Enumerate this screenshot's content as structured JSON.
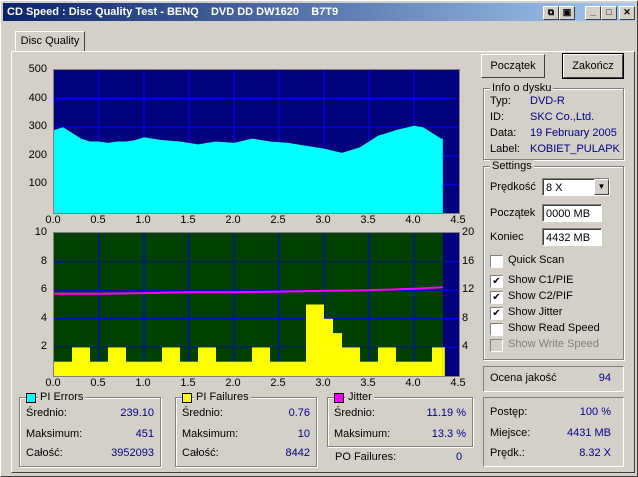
{
  "window": {
    "title": "CD Speed : Disc Quality Test - BENQ    DVD DD DW1620    B7T9",
    "tab": "Disc Quality"
  },
  "buttons": {
    "start": "Początek",
    "stop": "Zakończ"
  },
  "disc_info": {
    "title": "Info o dysku",
    "type_label": "Typ:",
    "type": "DVD-R",
    "id_label": "ID:",
    "id": "SKC Co.,Ltd.",
    "date_label": "Data:",
    "date": "19 February 2005",
    "label_label": "Label:",
    "label": "KOBIET_PULAPKA"
  },
  "settings": {
    "title": "Settings",
    "speed_label": "Prędkość",
    "speed": "8 X",
    "start_label": "Początek",
    "start": "0000 MB",
    "end_label": "Koniec",
    "end": "4432 MB",
    "quick_scan": "Quick Scan",
    "show_c1": "Show C1/PIE",
    "show_c2": "Show C2/PIF",
    "show_jitter": "Show Jitter",
    "show_read": "Show Read Speed",
    "show_write": "Show Write Speed"
  },
  "quality": {
    "label": "Ocena jakość",
    "value": "94"
  },
  "progress": {
    "progress_label": "Postęp:",
    "progress": "100 %",
    "position_label": "Miejsce:",
    "position": "4431 MB",
    "speed_label": "Prędk.:",
    "speed": "8.32 X"
  },
  "stats": {
    "pi_errors": {
      "title": "PI Errors",
      "avg_label": "Średnio:",
      "avg": "239.10",
      "max_label": "Maksimum:",
      "max": "451",
      "total_label": "Całość:",
      "total": "3952093"
    },
    "pi_failures": {
      "title": "PI Failures",
      "avg_label": "Średnio:",
      "avg": "0.76",
      "max_label": "Maksimum:",
      "max": "10",
      "total_label": "Całość:",
      "total": "8442"
    },
    "jitter": {
      "title": "Jitter",
      "avg_label": "Średnio:",
      "avg": "11.19 %",
      "max_label": "Maksimum:",
      "max": "13.3 %"
    },
    "po_failures": {
      "label": "PO Failures:",
      "value": "0"
    }
  },
  "colors": {
    "pie": "#00ffff",
    "pif": "#ffff00",
    "jitter": "#ff00ff",
    "chart_bg": "#00007d",
    "chart2_bg": "#004000",
    "grid": "#0000ff"
  },
  "chart_data": [
    {
      "type": "area",
      "series": [
        {
          "name": "PI Errors",
          "x": [
            0,
            0.1,
            0.2,
            0.3,
            0.4,
            0.5,
            0.6,
            0.7,
            0.8,
            0.9,
            1.0,
            1.2,
            1.4,
            1.6,
            1.8,
            2.0,
            2.2,
            2.4,
            2.6,
            2.8,
            3.0,
            3.2,
            3.4,
            3.6,
            3.8,
            4.0,
            4.1,
            4.2,
            4.3,
            4.32
          ],
          "values": [
            290,
            300,
            280,
            260,
            250,
            250,
            245,
            250,
            250,
            255,
            265,
            255,
            250,
            240,
            250,
            245,
            260,
            250,
            245,
            235,
            225,
            210,
            230,
            270,
            290,
            305,
            300,
            280,
            260,
            260
          ]
        }
      ],
      "xlim": [
        0,
        4.5
      ],
      "ylim": [
        0,
        500
      ],
      "x_ticks": [
        "0.0",
        "0.5",
        "1.0",
        "1.5",
        "2.0",
        "2.5",
        "3.0",
        "3.5",
        "4.0",
        "4.5"
      ],
      "y_ticks": [
        "500",
        "400",
        "300",
        "200",
        "100"
      ]
    },
    {
      "type": "bar",
      "series": [
        {
          "name": "PI Failures",
          "x": [
            0,
            0.2,
            0.4,
            0.6,
            0.8,
            1.0,
            1.2,
            1.4,
            1.6,
            1.8,
            2.0,
            2.2,
            2.4,
            2.6,
            2.8,
            2.9,
            3.0,
            3.1,
            3.2,
            3.4,
            3.6,
            3.8,
            4.0,
            4.2,
            4.32
          ],
          "values": [
            1,
            2,
            1,
            2,
            1,
            1,
            2,
            1,
            2,
            1,
            1,
            2,
            1,
            1,
            5,
            5,
            4,
            3,
            2,
            1,
            2,
            1,
            1,
            2,
            2
          ]
        },
        {
          "name": "Jitter",
          "x": [
            0,
            0.5,
            1.0,
            1.5,
            2.0,
            2.5,
            3.0,
            3.5,
            4.0,
            4.32
          ],
          "values": [
            11.5,
            11.5,
            11.6,
            11.7,
            11.7,
            11.8,
            11.9,
            12.0,
            12.2,
            12.4
          ]
        }
      ],
      "xlim": [
        0,
        4.5
      ],
      "ylim_left": [
        0,
        10
      ],
      "ylim_right": [
        0,
        20
      ],
      "x_ticks": [
        "0.0",
        "0.5",
        "1.0",
        "1.5",
        "2.0",
        "2.5",
        "3.0",
        "3.5",
        "4.0",
        "4.5"
      ],
      "y_ticks_left": [
        "10",
        "8",
        "6",
        "4",
        "2"
      ],
      "y_ticks_right": [
        "20",
        "16",
        "12",
        "8",
        "4"
      ]
    }
  ]
}
